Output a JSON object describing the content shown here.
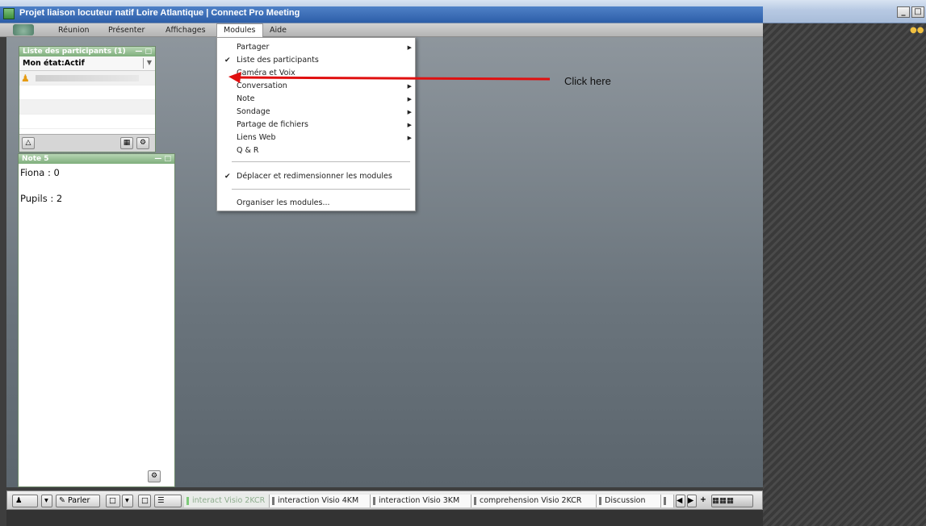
{
  "window": {
    "title": "Projet liaison locuteur natif Loire Atlantique | Connect Pro Meeting",
    "min": "_",
    "max": "□",
    "close": "×"
  },
  "menubar": {
    "items": [
      "Réunion",
      "Présenter",
      "Affichages",
      "Modules",
      "Aide"
    ]
  },
  "attendees_pod": {
    "title": "Liste des participants (1)",
    "status": "Mon état:Actif"
  },
  "notes_pod": {
    "title": "Note 5",
    "lines": [
      "Fiona : 0",
      "Pupils : 2"
    ]
  },
  "modules_menu": {
    "items": [
      {
        "label": "Partager",
        "checked": false,
        "submenu": true
      },
      {
        "label": "Liste des participants",
        "checked": true,
        "submenu": false
      },
      {
        "label": "Caméra et Voix",
        "checked": false,
        "submenu": false
      },
      {
        "label": "Conversation",
        "checked": false,
        "submenu": true
      },
      {
        "label": "Note",
        "checked": false,
        "submenu": true
      },
      {
        "label": "Sondage",
        "checked": false,
        "submenu": true
      },
      {
        "label": "Partage de fichiers",
        "checked": false,
        "submenu": true
      },
      {
        "label": "Liens Web",
        "checked": false,
        "submenu": true
      },
      {
        "label": "Q & R",
        "checked": false,
        "submenu": false
      },
      {
        "label": "Déplacer et redimensionner les modules",
        "checked": true,
        "submenu": false
      },
      {
        "label": "Organiser les modules...",
        "checked": false,
        "submenu": false
      }
    ]
  },
  "annotation": {
    "text": "Click here",
    "color": "#e01010"
  },
  "bottombar": {
    "talk_label": "Parler",
    "layouts": [
      "interact Visio 2KCR",
      "interaction Visio 4KM",
      "interaction Visio 3KM",
      "comprehension Visio 2KCR",
      "Discussion"
    ]
  }
}
